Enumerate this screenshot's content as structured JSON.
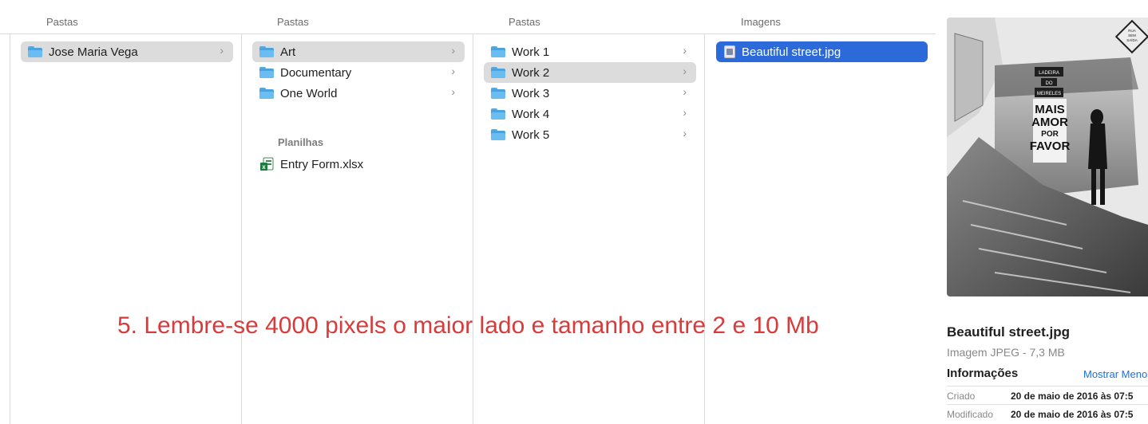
{
  "columns": [
    {
      "header": "Pastas",
      "items": [
        {
          "label": "Jose Maria Vega",
          "icon": "folder-icon",
          "state": "selected"
        }
      ]
    },
    {
      "header": "Pastas",
      "items": [
        {
          "label": "Art",
          "icon": "folder-icon",
          "state": "selected"
        },
        {
          "label": "Documentary",
          "icon": "folder-icon",
          "state": "none"
        },
        {
          "label": "One World",
          "icon": "folder-icon",
          "state": "none"
        }
      ],
      "section": {
        "label": "Planilhas",
        "items": [
          {
            "label": "Entry Form.xlsx",
            "icon": "excel-file-icon"
          }
        ]
      }
    },
    {
      "header": "Pastas",
      "items": [
        {
          "label": "Work 1",
          "icon": "folder-icon",
          "state": "none"
        },
        {
          "label": "Work 2",
          "icon": "folder-icon",
          "state": "selected"
        },
        {
          "label": "Work 3",
          "icon": "folder-icon",
          "state": "none"
        },
        {
          "label": "Work 4",
          "icon": "folder-icon",
          "state": "none"
        },
        {
          "label": "Work 5",
          "icon": "folder-icon",
          "state": "none"
        }
      ]
    },
    {
      "header": "Imagens",
      "items": [
        {
          "label": "Beautiful street.jpg",
          "icon": "image-file-icon",
          "state": "active"
        }
      ]
    }
  ],
  "overlay": {
    "text": "5. Lembre-se 4000 pixels o maior lado e tamanho entre 2 e 10 Mb",
    "color": "#d93a3a"
  },
  "preview": {
    "image_sign": [
      "MAIS",
      "AMOR",
      "POR",
      "FAVOR"
    ],
    "sign_header": [
      "LADEIRA",
      "DO",
      "MEIRELES"
    ],
    "road_sign": [
      "RUA",
      "SEM",
      "SAÍDA"
    ],
    "filename": "Beautiful street.jpg",
    "filetype": "Imagem JPEG - 7,3 MB",
    "info_title": "Informações",
    "show_less": "Mostrar Menos",
    "meta": [
      {
        "key": "Criado",
        "value": "20 de maio de 2016 às 07:5"
      },
      {
        "key": "Modificado",
        "value": "20 de maio de 2016 às 07:5"
      }
    ]
  },
  "colors": {
    "selection": "#dcdcdc",
    "active": "#2c6ad9",
    "folder": "#4aa3de",
    "link": "#1e6fe0"
  }
}
